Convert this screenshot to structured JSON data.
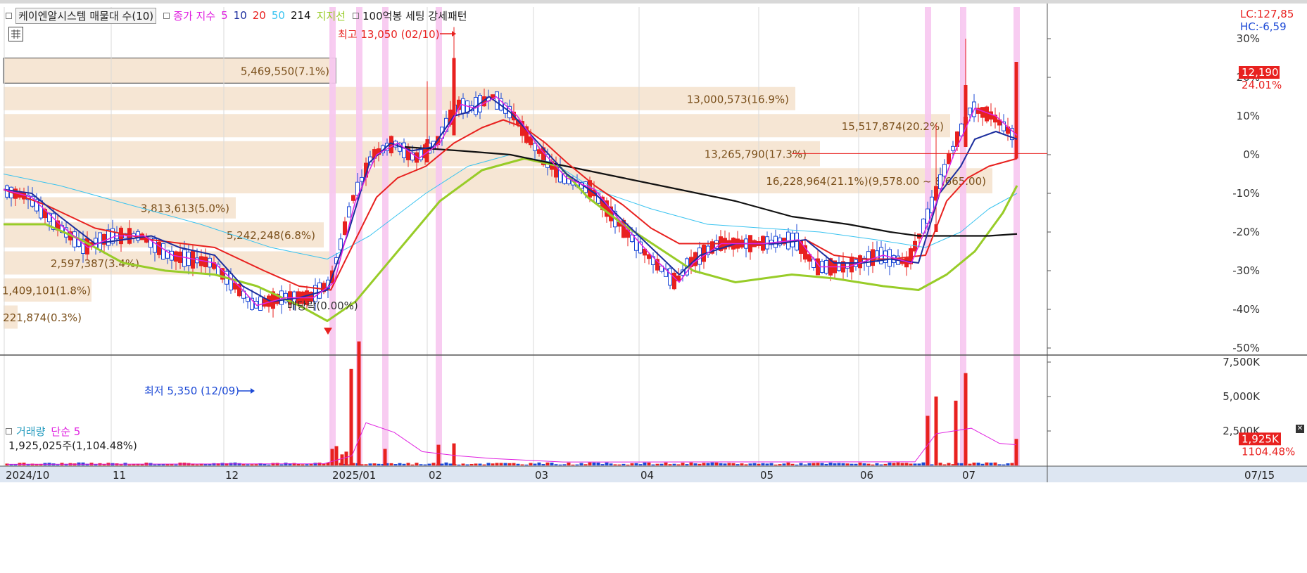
{
  "legend": {
    "indicator": "케이엔알시스템 매물대 수(10)",
    "close_index_label": "종가 지수",
    "ma5": "5",
    "ma10": "10",
    "ma20": "20",
    "ma50": "50",
    "ma214": "214",
    "support_label": "지지선",
    "pattern_label": "100억봉 세팅 강세패턴"
  },
  "top_right": {
    "lc": "LC:127,85",
    "hc": "HC:-6,59",
    "price_tag": "12,190",
    "price_pct": "24.01%",
    "vol_tag": "1,925K",
    "vol_pct": "1104.48%"
  },
  "annotations": {
    "high": "최고 13,050 (02/10)",
    "low": "최저 5,350 (12/09)",
    "dividend": "배당락(0.00%)"
  },
  "volume_legend": {
    "title": "거래량",
    "ma": "단순 5",
    "value": "1,925,025주(1,104.48%)"
  },
  "colors": {
    "up": "#e8211f",
    "down": "#1c49d6",
    "ma5": "#e020e0",
    "ma10": "#1c2e9e",
    "ma20": "#e8211f",
    "ma50": "#39c3f0",
    "ma214": "#111111",
    "support": "#98cc28",
    "profile": "#f6e6d4",
    "highlight": "#f7c6f0"
  },
  "chart_data": [
    {
      "type": "candlestick",
      "title": "케이엔알시스템",
      "y_axis_ticks": [
        "30%",
        "20%",
        "10%",
        "0%",
        "-10%",
        "-20%",
        "-30%",
        "-40%",
        "-50%"
      ],
      "y_range_pct": [
        -50,
        30
      ],
      "x_axis_labels": [
        "2024/10",
        "11",
        "12",
        "2025/01",
        "02",
        "03",
        "04",
        "05",
        "06",
        "07",
        "07/15"
      ],
      "volume_profile": [
        {
          "label": "5,469,550(7.1%)",
          "pct_top": 25,
          "pct_bottom": 18.5
        },
        {
          "label": "13,000,573(16.9%)",
          "pct_top": 17.5,
          "pct_bottom": 11.5
        },
        {
          "label": "15,517,874(20.2%)",
          "pct_top": 10.5,
          "pct_bottom": 4.5
        },
        {
          "label": "13,265,790(17.3%)",
          "pct_top": 3.5,
          "pct_bottom": -3
        },
        {
          "label": "16,228,964(21.1%)(9,578.00 ~ 8,665.00)",
          "pct_top": -3.5,
          "pct_bottom": -10
        },
        {
          "label": "3,813,613(5.0%)",
          "pct_top": -11,
          "pct_bottom": -16.5
        },
        {
          "label": "5,242,248(6.8%)",
          "pct_top": -17.5,
          "pct_bottom": -24
        },
        {
          "label": "2,597,387(3.4%)",
          "pct_top": -25,
          "pct_bottom": -31
        },
        {
          "label": "1,409,101(1.8%)",
          "pct_top": -32,
          "pct_bottom": -38
        },
        {
          "label": "221,874(0.3%)",
          "pct_top": -39,
          "pct_bottom": -45
        }
      ],
      "highlight_dates": [
        "2024-12-30",
        "2025-01-07",
        "2025-01-14",
        "2025-02-04",
        "2025-06-20",
        "2025-07-02",
        "2025-07-15"
      ],
      "ma20_points": [
        [
          0,
          -9
        ],
        [
          60,
          -13
        ],
        [
          130,
          -19
        ],
        [
          210,
          -22
        ],
        [
          300,
          -24
        ],
        [
          370,
          -30
        ],
        [
          420,
          -34
        ],
        [
          465,
          -35
        ],
        [
          500,
          -22
        ],
        [
          530,
          -11
        ],
        [
          560,
          -6
        ],
        [
          600,
          -3
        ],
        [
          640,
          3
        ],
        [
          680,
          7
        ],
        [
          710,
          9
        ],
        [
          740,
          7
        ],
        [
          770,
          3
        ],
        [
          800,
          -2
        ],
        [
          840,
          -8
        ],
        [
          880,
          -13
        ],
        [
          920,
          -19
        ],
        [
          960,
          -23
        ],
        [
          1000,
          -23
        ],
        [
          1050,
          -23
        ],
        [
          1100,
          -23
        ],
        [
          1140,
          -22
        ],
        [
          1180,
          -26
        ],
        [
          1220,
          -27
        ],
        [
          1260,
          -27
        ],
        [
          1310,
          -26
        ],
        [
          1340,
          -12
        ],
        [
          1370,
          -6
        ],
        [
          1400,
          -3
        ],
        [
          1440,
          -1
        ]
      ],
      "ma10_points": [
        [
          0,
          -9
        ],
        [
          40,
          -10
        ],
        [
          80,
          -16
        ],
        [
          130,
          -23
        ],
        [
          170,
          -22
        ],
        [
          210,
          -21
        ],
        [
          250,
          -24
        ],
        [
          300,
          -26
        ],
        [
          340,
          -34
        ],
        [
          380,
          -38
        ],
        [
          420,
          -37
        ],
        [
          460,
          -35
        ],
        [
          490,
          -20
        ],
        [
          520,
          -2
        ],
        [
          550,
          3
        ],
        [
          580,
          1
        ],
        [
          610,
          2
        ],
        [
          640,
          10
        ],
        [
          660,
          11
        ],
        [
          690,
          15
        ],
        [
          720,
          11
        ],
        [
          760,
          3
        ],
        [
          800,
          -5
        ],
        [
          840,
          -10
        ],
        [
          880,
          -17
        ],
        [
          920,
          -24
        ],
        [
          960,
          -31
        ],
        [
          990,
          -26
        ],
        [
          1040,
          -23
        ],
        [
          1100,
          -23
        ],
        [
          1140,
          -22
        ],
        [
          1180,
          -28
        ],
        [
          1220,
          -28
        ],
        [
          1260,
          -27
        ],
        [
          1300,
          -28
        ],
        [
          1330,
          -10
        ],
        [
          1360,
          -3
        ],
        [
          1380,
          4
        ],
        [
          1410,
          6
        ],
        [
          1440,
          4
        ]
      ],
      "ma5_points": [
        [
          0,
          -9
        ],
        [
          40,
          -11
        ],
        [
          80,
          -18
        ],
        [
          120,
          -24
        ],
        [
          160,
          -21
        ],
        [
          200,
          -21
        ],
        [
          240,
          -26
        ],
        [
          300,
          -28
        ],
        [
          340,
          -35
        ],
        [
          360,
          -39
        ],
        [
          400,
          -37
        ],
        [
          440,
          -37
        ],
        [
          470,
          -33
        ],
        [
          500,
          -12
        ],
        [
          530,
          0
        ],
        [
          560,
          3
        ],
        [
          590,
          -1
        ],
        [
          620,
          3
        ],
        [
          650,
          13
        ],
        [
          670,
          12
        ],
        [
          700,
          15
        ],
        [
          730,
          10
        ],
        [
          760,
          2
        ],
        [
          800,
          -6
        ],
        [
          840,
          -9
        ],
        [
          880,
          -18
        ],
        [
          920,
          -26
        ],
        [
          960,
          -33
        ],
        [
          980,
          -28
        ],
        [
          1020,
          -23
        ],
        [
          1080,
          -23
        ],
        [
          1130,
          -22
        ],
        [
          1160,
          -29
        ],
        [
          1200,
          -29
        ],
        [
          1250,
          -26
        ],
        [
          1290,
          -28
        ],
        [
          1320,
          -15
        ],
        [
          1350,
          0
        ],
        [
          1380,
          12
        ],
        [
          1410,
          10
        ],
        [
          1440,
          5
        ]
      ],
      "ma50_points": [
        [
          0,
          -5
        ],
        [
          80,
          -8
        ],
        [
          180,
          -13
        ],
        [
          280,
          -18
        ],
        [
          380,
          -24
        ],
        [
          460,
          -27
        ],
        [
          520,
          -21
        ],
        [
          600,
          -10
        ],
        [
          660,
          -3
        ],
        [
          720,
          0
        ],
        [
          780,
          -2
        ],
        [
          840,
          -9
        ],
        [
          920,
          -14
        ],
        [
          1000,
          -18
        ],
        [
          1080,
          -19
        ],
        [
          1160,
          -20
        ],
        [
          1240,
          -22
        ],
        [
          1310,
          -24
        ],
        [
          1360,
          -20
        ],
        [
          1400,
          -14
        ],
        [
          1440,
          -10
        ]
      ],
      "ma214_points": [
        [
          570,
          2
        ],
        [
          650,
          1
        ],
        [
          720,
          0
        ],
        [
          800,
          -3
        ],
        [
          880,
          -6
        ],
        [
          960,
          -9
        ],
        [
          1040,
          -12
        ],
        [
          1120,
          -16
        ],
        [
          1200,
          -18
        ],
        [
          1260,
          -20
        ],
        [
          1300,
          -21
        ],
        [
          1350,
          -21
        ],
        [
          1400,
          -21
        ],
        [
          1440,
          -20.5
        ]
      ],
      "support_points": [
        [
          0,
          -18
        ],
        [
          60,
          -18
        ],
        [
          110,
          -22
        ],
        [
          170,
          -28
        ],
        [
          230,
          -30
        ],
        [
          300,
          -31
        ],
        [
          360,
          -34
        ],
        [
          420,
          -39
        ],
        [
          460,
          -43
        ],
        [
          500,
          -38
        ],
        [
          560,
          -25
        ],
        [
          620,
          -12
        ],
        [
          680,
          -4
        ],
        [
          740,
          -1
        ],
        [
          790,
          -3
        ],
        [
          830,
          -11
        ],
        [
          880,
          -18
        ],
        [
          930,
          -24
        ],
        [
          980,
          -30
        ],
        [
          1040,
          -33
        ],
        [
          1120,
          -31
        ],
        [
          1180,
          -32
        ],
        [
          1250,
          -34
        ],
        [
          1300,
          -35
        ],
        [
          1340,
          -31
        ],
        [
          1380,
          -25
        ],
        [
          1420,
          -15
        ],
        [
          1440,
          -8
        ]
      ]
    },
    {
      "type": "bar",
      "title": "거래량",
      "y_axis_ticks": [
        "7,500K",
        "5,000K",
        "2,500K"
      ],
      "y_range_k": [
        0,
        9500
      ],
      "last_value_k": 1925
    }
  ]
}
